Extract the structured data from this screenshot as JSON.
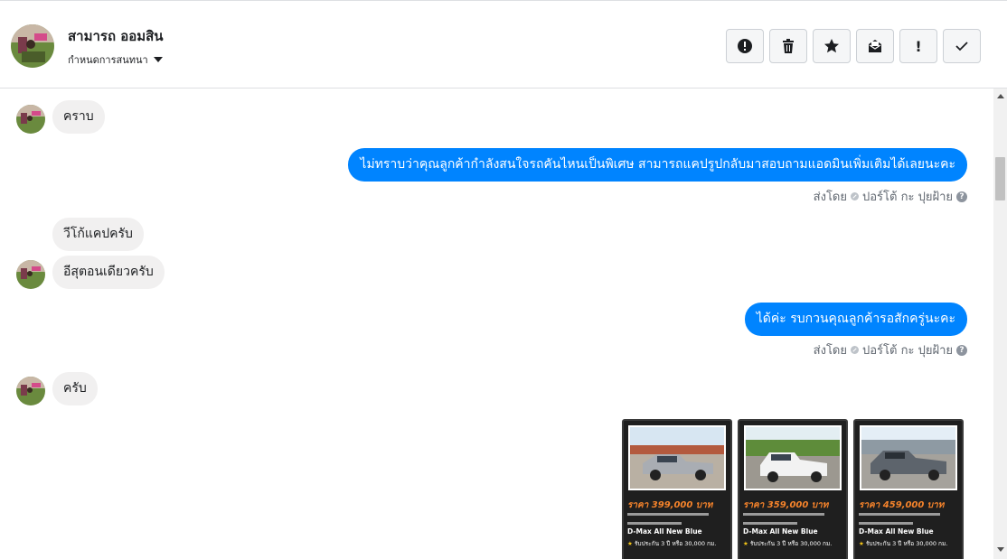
{
  "contact": {
    "name": "สามารถ ออมสิน",
    "settings_label": "กำหนดการสนทนา"
  },
  "actions": [
    {
      "name": "spam",
      "icon": "alert-circle-icon"
    },
    {
      "name": "delete",
      "icon": "trash-icon"
    },
    {
      "name": "star",
      "icon": "star-icon"
    },
    {
      "name": "mark-unread",
      "icon": "envelope-icon"
    },
    {
      "name": "follow-up",
      "icon": "exclamation-icon",
      "label": "!"
    },
    {
      "name": "done",
      "icon": "check-icon"
    }
  ],
  "messages": {
    "m1": "คราบ",
    "m2": "ไม่ทราบว่าคุณลูกค้ากำลังสนใจรถคันไหนเป็นพิเศษ สามารถแคปรูปกลับมาสอบถามแอดมินเพิ่มเติมได้เลยนะคะ",
    "m3": "วีโก้แคปครับ",
    "m4": "อีสุตอนเดียวครับ",
    "m5": "ได้ค่ะ รบกวนคุณลูกค้ารอสักครู่นะคะ",
    "m6": "ครับ"
  },
  "sent_by": {
    "prefix": "ส่งโดย",
    "agent": "ปอร์โต้ กะ ปุยฝ้าย",
    "help": "?"
  },
  "cards": [
    {
      "price": "ราคา 399,000 บาท",
      "model": "D-Max All New Blue",
      "warranty": "รับประกัน 3 ปี หรือ 30,000 กม."
    },
    {
      "price": "ราคา 359,000 บาท",
      "model": "D-Max All New Blue",
      "warranty": "รับประกัน 3 ปี หรือ 30,000 กม."
    },
    {
      "price": "ราคา 459,000 บาท",
      "model": "D-Max All New Blue",
      "warranty": "รับประกัน 3 ปี หรือ 30,000 กม."
    }
  ],
  "colors": {
    "outgoing_bubble": "#0084ff",
    "incoming_bubble": "#f1f0f0",
    "price_text": "#f5832b"
  }
}
